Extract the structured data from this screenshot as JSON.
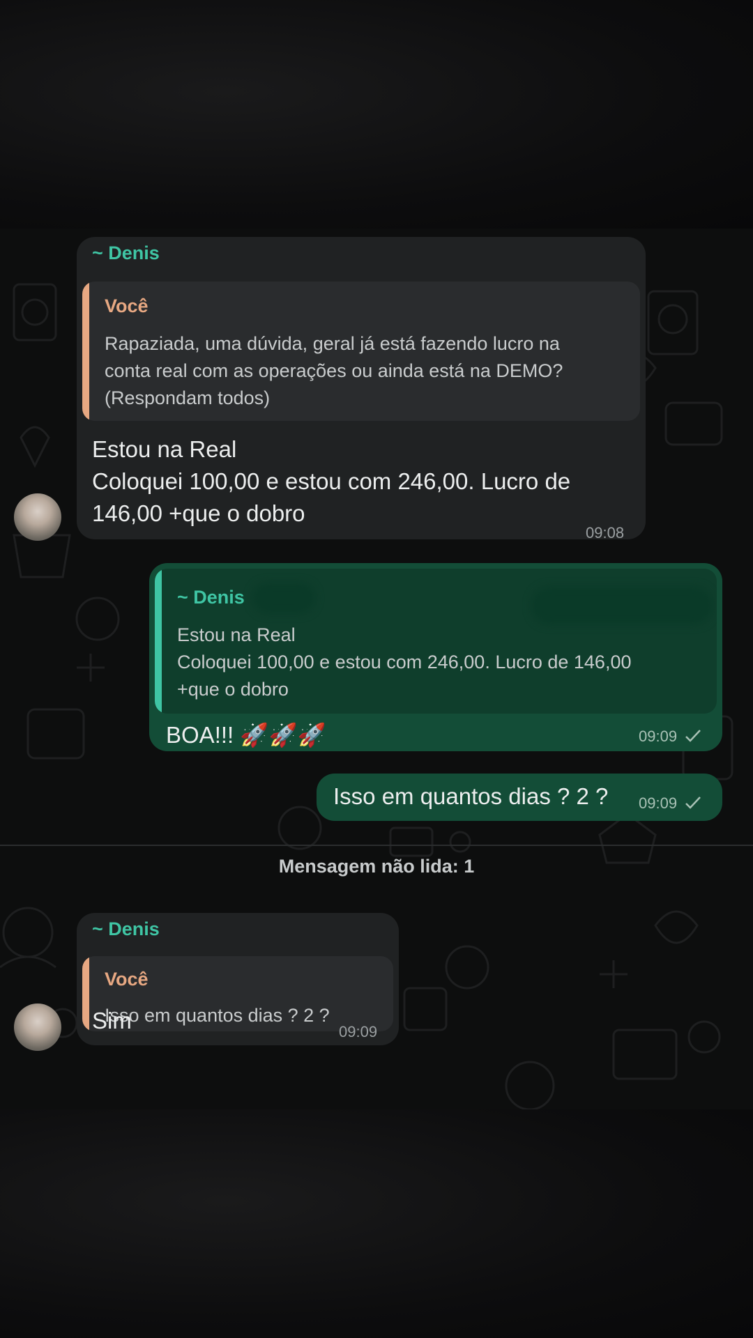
{
  "messages": [
    {
      "sender": "~ Denis",
      "quote_name": "Você",
      "quote_text": "Rapaziada, uma dúvida, geral já está fazendo lucro na\nconta real com as operações ou ainda está na DEMO?\n(Respondam todos)",
      "text": "Estou na Real\nColoquei 100,00 e estou com 246,00. Lucro de\n146,00 +que o dobro",
      "time": "09:08"
    },
    {
      "quote_name": "~ Denis",
      "quote_text": "Estou na Real\nColoquei 100,00 e estou com 246,00. Lucro de 146,00\n+que o dobro",
      "text": "BOA!!! 🚀🚀🚀",
      "time": "09:09"
    },
    {
      "text": "Isso em quantos dias ? 2 ?",
      "time": "09:09"
    },
    {
      "sender": "~ Denis",
      "quote_name": "Você",
      "quote_text": "Isso em quantos dias ? 2 ?",
      "text": "Sim",
      "time": "09:09"
    }
  ],
  "unread_divider": "Mensagem não lida: 1",
  "colors": {
    "sender": "#3fc5a4",
    "quote_you": "#e7a882",
    "incoming_bubble": "#202223",
    "outgoing_bubble": "#134d37"
  }
}
